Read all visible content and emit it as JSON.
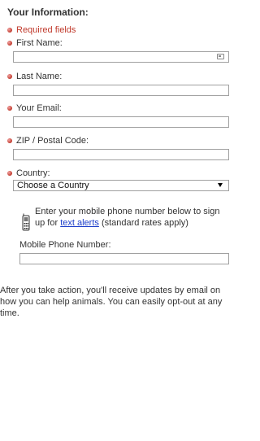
{
  "form": {
    "heading": "Your Information:",
    "required_note": "Required fields",
    "first_name_label": "First Name:",
    "last_name_label": "Last Name:",
    "email_label": "Your Email:",
    "zip_label": "ZIP / Postal Code:",
    "country_label": "Country:",
    "country_select_value": "Choose a Country"
  },
  "sms": {
    "text_before": "Enter your mobile phone number below to sign up for",
    "link_text": "text alerts",
    "text_after": "(standard rates apply)",
    "mobile_label": "Mobile Phone Number:"
  },
  "footer": {
    "text": "After you take action, you'll receive updates by email on how you can help animals. You can easily opt-out at any time."
  },
  "colors": {
    "required": "#c0392b",
    "link": "#1a3cc9"
  },
  "icons": {
    "card": "contact-card-icon",
    "phone": "mobile-phone-icon",
    "dropdown": "chevron-down-icon"
  }
}
